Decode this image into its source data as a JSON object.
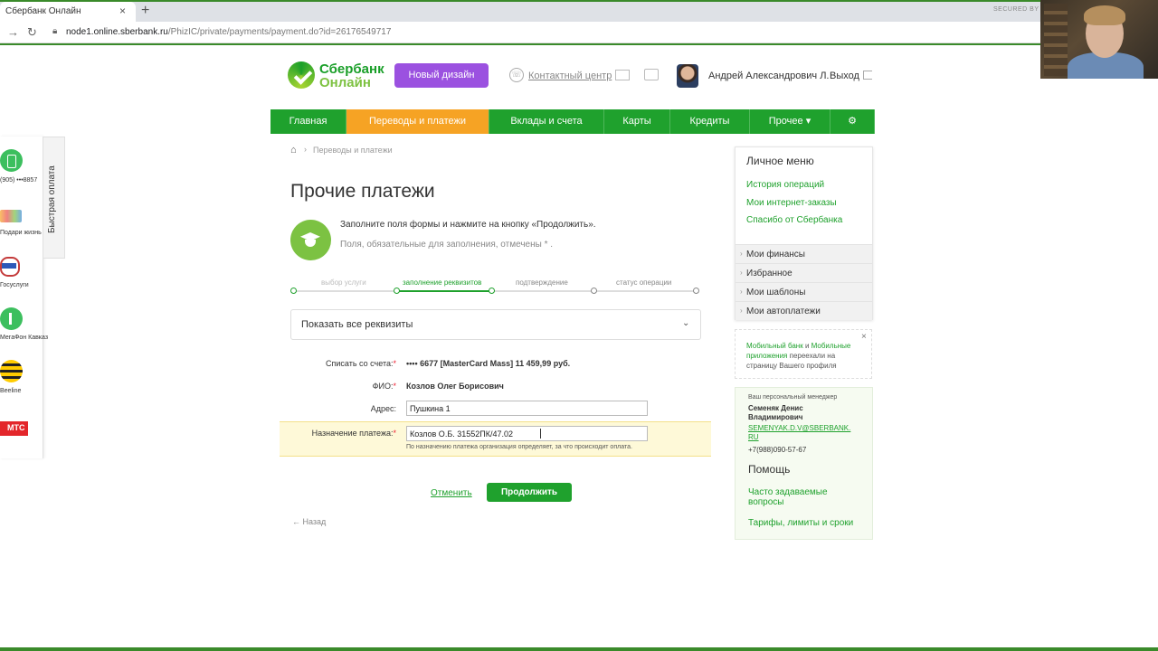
{
  "browser": {
    "tab_title": "Сбербанк Онлайн",
    "tab_close": "×",
    "new_tab": "+",
    "secured_badge": "SECURED BY",
    "back_icon": "arrow-right-icon",
    "url_host": "node1.online.sberbank.ru",
    "url_path": "/PhizIC/private/payments/payment.do?id=26176549717"
  },
  "header": {
    "logo_title": "Сбербанк",
    "logo_subtitle": "Онлайн",
    "new_design_button": "Новый дизайн",
    "contact_center": "Контактный центр",
    "user_name": "Андрей Александрович Л.",
    "logout": "Выход"
  },
  "main_nav": [
    {
      "label": "Главная",
      "active": false,
      "width": 84
    },
    {
      "label": "Переводы и платежи",
      "active": true,
      "width": 158
    },
    {
      "label": "Вклады и счета",
      "active": false,
      "width": 127
    },
    {
      "label": "Карты",
      "active": false,
      "width": 73
    },
    {
      "label": "Кредиты",
      "active": false,
      "width": 88
    },
    {
      "label": "Прочее ▾",
      "active": false,
      "width": 89
    },
    {
      "label": "⚙",
      "active": false,
      "width": 49
    }
  ],
  "breadcrumb": {
    "home_icon": "home-icon",
    "separator": "›",
    "current": "Переводы и платежи"
  },
  "page": {
    "title": "Прочие платежи",
    "hint_primary": "Заполните поля формы и нажмите на кнопку «Продолжить».",
    "hint_secondary": "Поля, обязательные для заполнения, отмечены * ."
  },
  "steps": [
    {
      "label": "выбор услуги",
      "state": "done"
    },
    {
      "label": "заполнение реквизитов",
      "state": "current"
    },
    {
      "label": "подтверждение",
      "state": "pending"
    },
    {
      "label": "статус операции",
      "state": "pending"
    }
  ],
  "show_all_label": "Показать все реквизиты",
  "form": {
    "account_label": "Списать со счета:",
    "account_value": "•••• 6677  [MasterCard Mass] 11 459,99   руб.",
    "fio_label": "ФИО:",
    "fio_value": "Козлов Олег Борисович",
    "address_label": "Адрес:",
    "address_value": "Пушкина 1",
    "purpose_label": "Назначение платежа:",
    "purpose_value": "Козлов О.Б. 31552ПК/47.02",
    "purpose_note": "По назначению платежа организация определяет, за что происходит оплата.",
    "required_mark": "*"
  },
  "actions": {
    "cancel": "Отменить",
    "continue": "Продолжить",
    "back": "← Назад"
  },
  "sidebar": {
    "personal_menu_title": "Личное меню",
    "links": [
      "История операций",
      "Мои интернет-заказы",
      "Спасибо от Сбербанка"
    ],
    "sections": [
      "Мои финансы",
      "Избранное",
      "Мои шаблоны",
      "Мои автоплатежи"
    ],
    "mobile_notice_part1": "Мобильный банк",
    "mobile_notice_and": " и ",
    "mobile_notice_part2": "Мобильные приложения",
    "mobile_notice_rest": " переехали на страницу Вашего профиля",
    "close": "×",
    "manager_caption": "Ваш персональный менеджер",
    "manager_name_line1": "Семеняк Денис",
    "manager_name_line2": "Владимирович",
    "manager_email_line1": "SEMENYAK.D.V@SBERBANK.",
    "manager_email_line2": "RU",
    "manager_phone": "+7(988)090-57-67",
    "help_title": "Помощь",
    "help_links": [
      "Часто задаваемые",
      "вопросы",
      "Тарифы, лимиты и сроки"
    ]
  },
  "quick_pay": {
    "tab_label": "Быстрая оплата",
    "items": [
      "(905) •••8857",
      "Подари жизнь",
      "Госуслуги",
      "МегаФон Кавказ",
      "Beeline",
      "МТС"
    ]
  },
  "colors": {
    "brand_green": "#1fa12d",
    "nav_active_orange": "#f6a324",
    "new_design_purple": "#9b51e0",
    "highlight_yellow": "#fef9d8"
  }
}
